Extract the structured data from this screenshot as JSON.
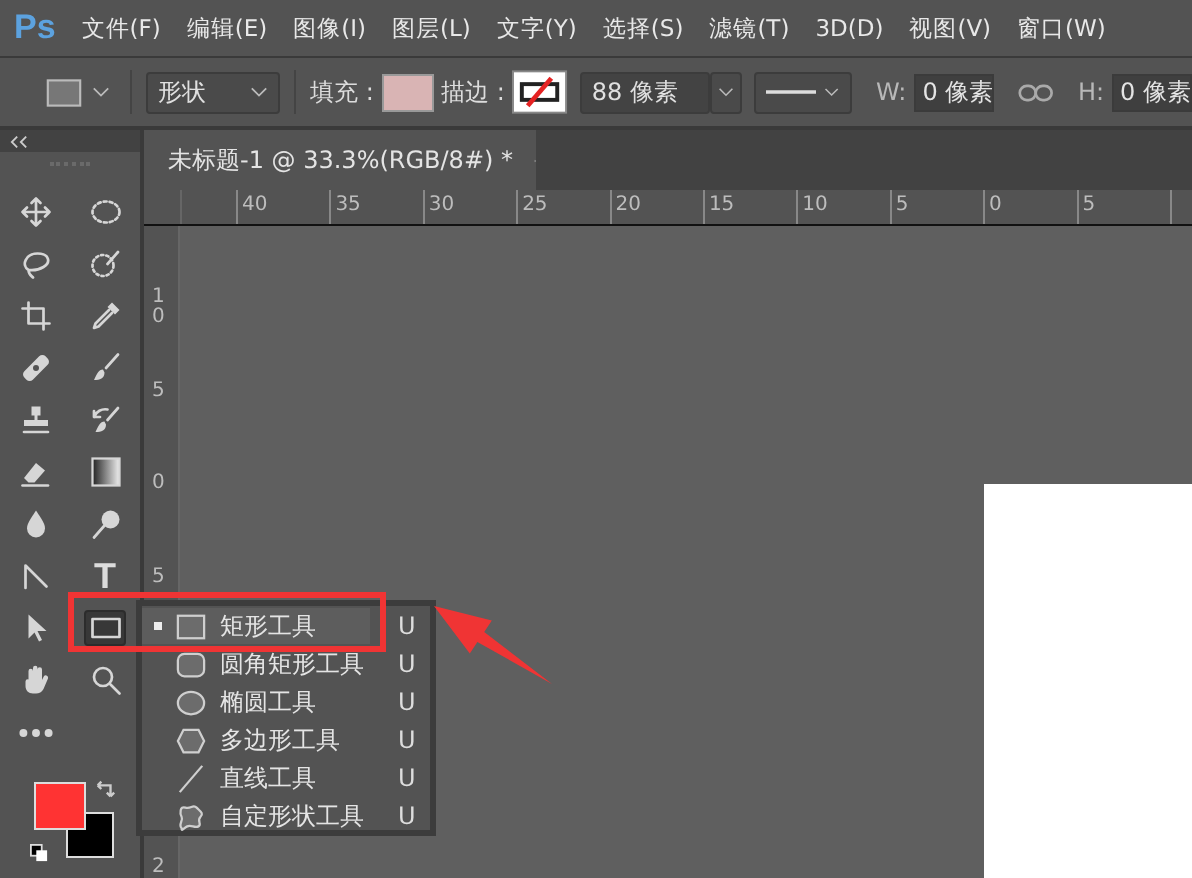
{
  "menu_bar": {
    "logo": "Ps",
    "items": [
      "文件(F)",
      "编辑(E)",
      "图像(I)",
      "图层(L)",
      "文字(Y)",
      "选择(S)",
      "滤镜(T)",
      "3D(D)",
      "视图(V)",
      "窗口(W)"
    ]
  },
  "options_bar": {
    "mode": "形状",
    "fill_label": "填充 :",
    "stroke_label": "描边 :",
    "stroke_width": "88 像素",
    "w_label": "W:",
    "w_value": "0 像素",
    "h_label": "H:",
    "h_value": "0 像素"
  },
  "tools": [
    {
      "kind": "move",
      "selected": false
    },
    {
      "kind": "marquee",
      "selected": false
    },
    {
      "kind": "lasso",
      "selected": false
    },
    {
      "kind": "quick-select",
      "selected": false
    },
    {
      "kind": "crop",
      "selected": false
    },
    {
      "kind": "eyedropper",
      "selected": false
    },
    {
      "kind": "healing",
      "selected": false
    },
    {
      "kind": "brush",
      "selected": false
    },
    {
      "kind": "stamp",
      "selected": false
    },
    {
      "kind": "history-brush",
      "selected": false
    },
    {
      "kind": "eraser",
      "selected": false
    },
    {
      "kind": "gradient",
      "selected": false
    },
    {
      "kind": "blur",
      "selected": false
    },
    {
      "kind": "dodge",
      "selected": false
    },
    {
      "kind": "pen",
      "selected": false
    },
    {
      "kind": "type",
      "label": "T",
      "selected": false
    },
    {
      "kind": "path-select",
      "selected": false
    },
    {
      "kind": "rectangle",
      "selected": true
    },
    {
      "kind": "hand",
      "selected": false
    },
    {
      "kind": "zoom",
      "selected": false
    },
    {
      "kind": "more",
      "selected": false
    }
  ],
  "document_tab": {
    "title": "未标题-1 @ 33.3%(RGB/8#) *"
  },
  "rulers": {
    "horizontal": [
      "40",
      "35",
      "30",
      "25",
      "20",
      "15",
      "10",
      "5",
      "0",
      "5"
    ],
    "vertical": [
      "10",
      "5",
      "0",
      "5",
      "2"
    ]
  },
  "flyout": {
    "items": [
      {
        "kind": "rectangle",
        "label": "矩形工具",
        "shortcut": "U",
        "selected": true
      },
      {
        "kind": "rounded-rectangle",
        "label": "圆角矩形工具",
        "shortcut": "U",
        "selected": false
      },
      {
        "kind": "ellipse",
        "label": "椭圆工具",
        "shortcut": "U",
        "selected": false
      },
      {
        "kind": "polygon",
        "label": "多边形工具",
        "shortcut": "U",
        "selected": false
      },
      {
        "kind": "line",
        "label": "直线工具",
        "shortcut": "U",
        "selected": false
      },
      {
        "kind": "custom-shape",
        "label": "自定形状工具",
        "shortcut": "U",
        "selected": false
      }
    ]
  }
}
